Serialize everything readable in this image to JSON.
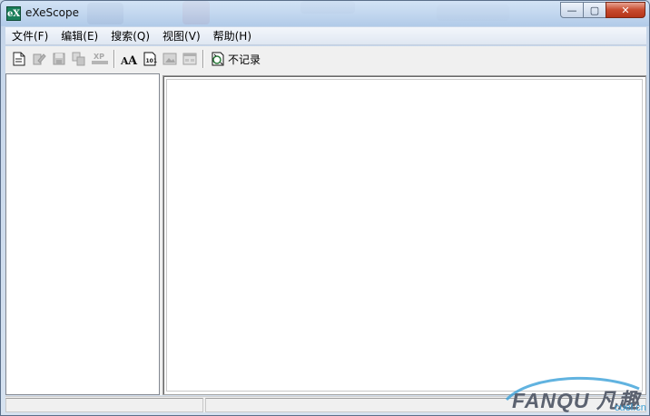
{
  "window": {
    "title": "eXeScope",
    "app_icon_glyph": "eX",
    "controls": {
      "minimize": "—",
      "maximize": "▢",
      "close": "✕"
    }
  },
  "menu": [
    {
      "label": "文件(F)"
    },
    {
      "label": "编辑(E)"
    },
    {
      "label": "搜索(Q)"
    },
    {
      "label": "视图(V)"
    },
    {
      "label": "帮助(H)"
    }
  ],
  "toolbar": {
    "buttons": [
      {
        "icon": "new-file-icon",
        "enabled": true
      },
      {
        "icon": "edit-icon",
        "enabled": false
      },
      {
        "icon": "save-icon",
        "enabled": false
      },
      {
        "icon": "copy-icon",
        "enabled": false
      },
      {
        "icon": "xp-icon",
        "label": "XP",
        "enabled": false
      },
      {
        "icon": "font-icon",
        "label": "AA",
        "enabled": true
      },
      {
        "icon": "resource-icon",
        "enabled": true
      },
      {
        "icon": "image-icon",
        "enabled": false
      },
      {
        "icon": "dialog-icon",
        "enabled": false
      }
    ],
    "no_record_label": "不记录"
  },
  "watermark": {
    "main": "FANQU 凡趣",
    "sub": "cuel.cn"
  },
  "colors": {
    "accent": "#1a7f5a",
    "close_red": "#c74a2e",
    "titlebar": "#b9d1ea"
  }
}
